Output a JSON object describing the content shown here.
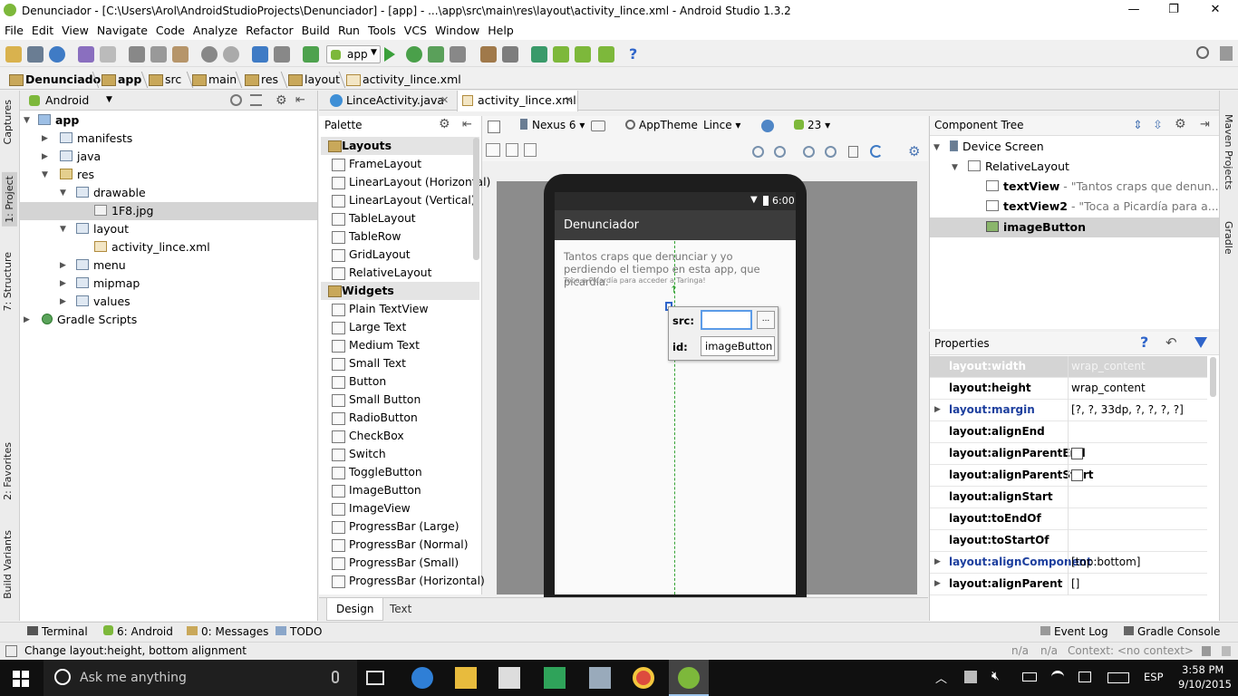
{
  "window": {
    "title": "Denunciador - [C:\\Users\\Arol\\AndroidStudioProjects\\Denunciador] - [app] - ...\\app\\src\\main\\res\\layout\\activity_lince.xml - Android Studio 1.3.2",
    "minimize": "—",
    "restore": "❐",
    "close": "✕"
  },
  "menu": [
    "File",
    "Edit",
    "View",
    "Navigate",
    "Code",
    "Analyze",
    "Refactor",
    "Build",
    "Run",
    "Tools",
    "VCS",
    "Window",
    "Help"
  ],
  "toolbar": {
    "run_config": "app",
    "help": "?"
  },
  "breadcrumbs": [
    "Denunciador",
    "app",
    "src",
    "main",
    "res",
    "layout",
    "activity_lince.xml"
  ],
  "left_tabs": [
    "1: Project",
    "7: Structure",
    "Captures",
    "2: Favorites",
    "Build Variants"
  ],
  "right_tabs": [
    "Maven Projects",
    "Gradle"
  ],
  "project": {
    "view": "Android",
    "tree": [
      {
        "label": "app",
        "bold": true
      },
      {
        "label": "manifests"
      },
      {
        "label": "java"
      },
      {
        "label": "res"
      },
      {
        "label": "drawable"
      },
      {
        "label": "1F8.jpg"
      },
      {
        "label": "layout"
      },
      {
        "label": "activity_lince.xml"
      },
      {
        "label": "menu"
      },
      {
        "label": "mipmap"
      },
      {
        "label": "values"
      },
      {
        "label": "Gradle Scripts"
      }
    ]
  },
  "editor_tabs": [
    "LinceActivity.java",
    "activity_lince.xml"
  ],
  "palette": {
    "title": "Palette",
    "sections": [
      {
        "name": "Layouts",
        "items": [
          "FrameLayout",
          "LinearLayout (Horizontal)",
          "LinearLayout (Vertical)",
          "TableLayout",
          "TableRow",
          "GridLayout",
          "RelativeLayout"
        ]
      },
      {
        "name": "Widgets",
        "items": [
          "Plain TextView",
          "Large Text",
          "Medium Text",
          "Small Text",
          "Button",
          "Small Button",
          "RadioButton",
          "CheckBox",
          "Switch",
          "ToggleButton",
          "ImageButton",
          "ImageView",
          "ProgressBar (Large)",
          "ProgressBar (Normal)",
          "ProgressBar (Small)",
          "ProgressBar (Horizontal)"
        ]
      }
    ]
  },
  "design_toolbar": {
    "device": "Nexus 6",
    "theme": "AppTheme",
    "activity": "Lince",
    "api": "23"
  },
  "phone": {
    "time": "6:00",
    "app_title": "Denunciador",
    "text1": "Tantos craps que denunciar y yo perdiendo el tiempo en esta app, que picardía.",
    "text2": "Toca a Picardía para acceder a Taringa!"
  },
  "popup": {
    "src_label": "src:",
    "src_value": "",
    "browse": "...",
    "id_label": "id:",
    "id_value": "imageButton"
  },
  "bottom_tabs": [
    "Design",
    "Text"
  ],
  "component_tree": {
    "title": "Component Tree",
    "items": [
      {
        "label": "Device Screen",
        "hint": ""
      },
      {
        "label": "RelativeLayout",
        "hint": ""
      },
      {
        "label": "textView",
        "hint": " - \"Tantos craps que denun...rdía.\""
      },
      {
        "label": "textView2",
        "hint": " - \"Toca a Picardía para a...inga!\""
      },
      {
        "label": "imageButton",
        "hint": ""
      }
    ]
  },
  "properties": {
    "title": "Properties",
    "rows": [
      {
        "k": "layout:width",
        "v": "wrap_content"
      },
      {
        "k": "layout:height",
        "v": "wrap_content"
      },
      {
        "k": "layout:margin",
        "v": "[?, ?, 33dp, ?, ?, ?, ?]"
      },
      {
        "k": "layout:alignEnd",
        "v": ""
      },
      {
        "k": "layout:alignParentEnd",
        "v": ""
      },
      {
        "k": "layout:alignParentStart",
        "v": ""
      },
      {
        "k": "layout:alignStart",
        "v": ""
      },
      {
        "k": "layout:toEndOf",
        "v": ""
      },
      {
        "k": "layout:toStartOf",
        "v": ""
      },
      {
        "k": "layout:alignComponent",
        "v": "[top:bottom]"
      },
      {
        "k": "layout:alignParent",
        "v": "[]"
      }
    ]
  },
  "tool_windows": [
    "Terminal",
    "6: Android",
    "0: Messages",
    "TODO",
    "Event Log",
    "Gradle Console"
  ],
  "status": {
    "message": "Change layout:height, bottom alignment",
    "na1": "n/a",
    "na2": "n/a",
    "context": "Context: <no context>"
  },
  "taskbar": {
    "search": "Ask me anything",
    "lang": "ESP",
    "time": "3:58 PM",
    "date": "9/10/2015"
  },
  "colors": {
    "accent": "#2f65ca",
    "android_green": "#7db83b",
    "selected_row": "#d4d4d4"
  }
}
